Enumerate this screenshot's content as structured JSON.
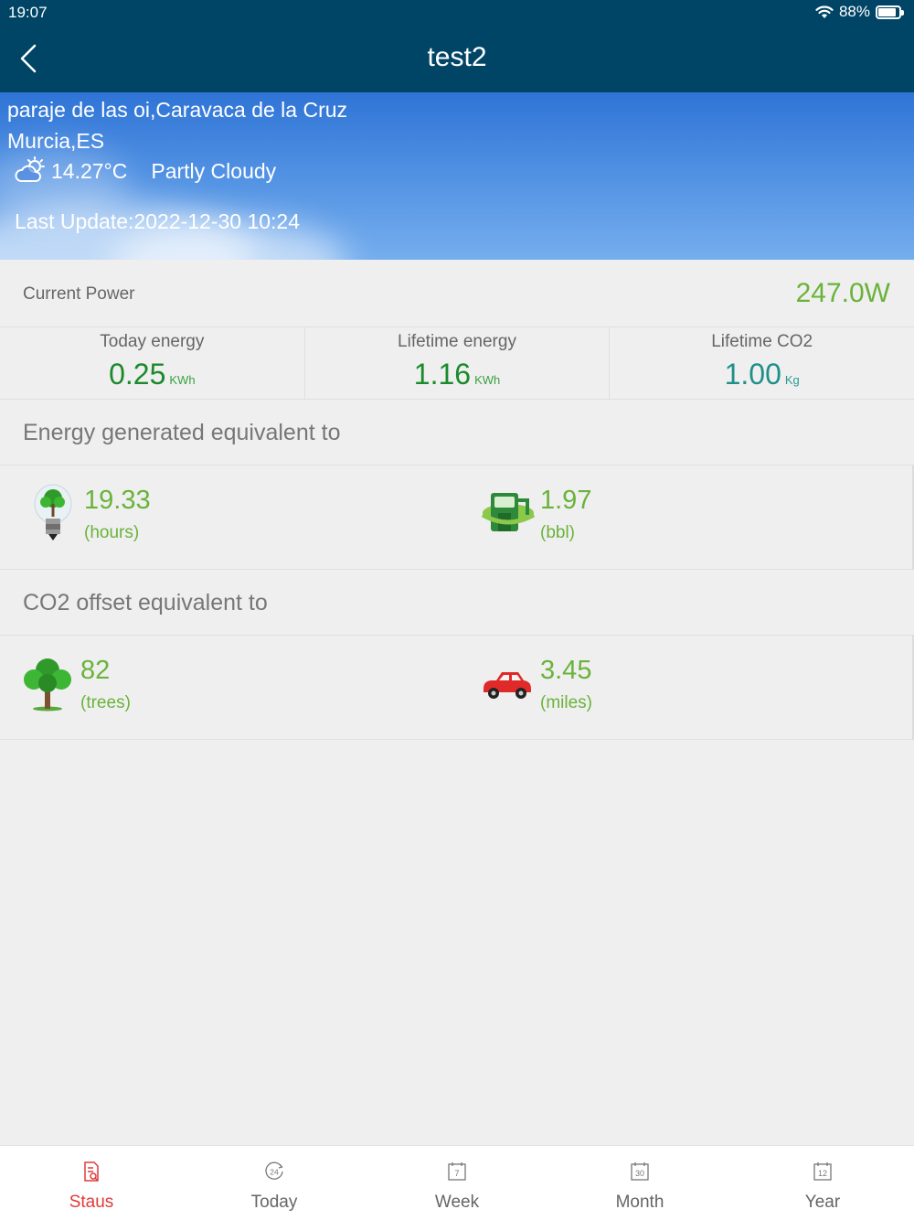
{
  "status_bar": {
    "time": "19:07",
    "battery": "88%",
    "battery_level": 0.88
  },
  "nav": {
    "title": "test2",
    "back_icon": "chevron-left-icon"
  },
  "weather": {
    "location_line1": "paraje de las oi,Caravaca de la Cruz",
    "location_line2": "Murcia,ES",
    "icon": "partly-cloudy-icon",
    "temperature": "14.27°C",
    "condition": "Partly Cloudy",
    "last_update": "Last Update:2022-12-30 10:24"
  },
  "current_power": {
    "label": "Current Power",
    "value": "247.0W"
  },
  "stats": [
    {
      "label": "Today energy",
      "value": "0.25",
      "unit": "KWh"
    },
    {
      "label": "Lifetime energy",
      "value": "1.16",
      "unit": "KWh"
    },
    {
      "label": "Lifetime CO2",
      "value": "1.00",
      "unit": "Kg"
    }
  ],
  "energy_equivalent": {
    "heading": "Energy generated equivalent to",
    "items": [
      {
        "icon": "light-bulb-tree-icon",
        "value": "19.33",
        "unit": "(hours)"
      },
      {
        "icon": "oil-barrel-icon",
        "value": "1.97",
        "unit": "(bbl)"
      }
    ]
  },
  "co2_equivalent": {
    "heading": "CO2 offset equivalent to",
    "items": [
      {
        "icon": "tree-icon",
        "value": "82",
        "unit": "(trees)"
      },
      {
        "icon": "car-icon",
        "value": "3.45",
        "unit": "(miles)"
      }
    ]
  },
  "colors": {
    "nav_bg": "#004566",
    "accent_green": "#6ab33a",
    "active_tab": "#e03a3a"
  },
  "tabs": [
    {
      "label": "Staus",
      "icon": "report-icon",
      "icon_text": "",
      "active": true
    },
    {
      "label": "Today",
      "icon": "clock-24-icon",
      "icon_text": "24",
      "active": false
    },
    {
      "label": "Week",
      "icon": "calendar-7-icon",
      "icon_text": "7",
      "active": false
    },
    {
      "label": "Month",
      "icon": "calendar-30-icon",
      "icon_text": "30",
      "active": false
    },
    {
      "label": "Year",
      "icon": "calendar-12-icon",
      "icon_text": "12",
      "active": false
    }
  ]
}
